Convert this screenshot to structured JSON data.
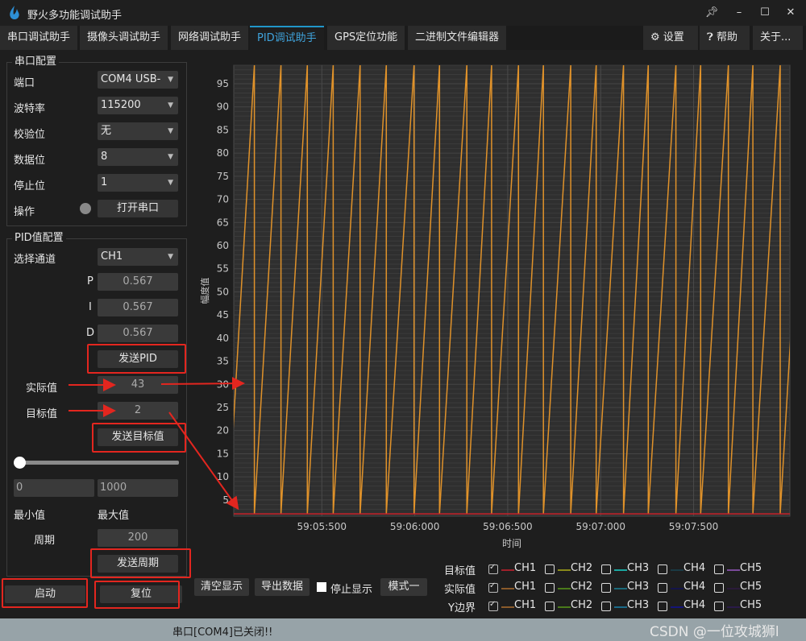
{
  "window": {
    "title": "野火多功能调试助手",
    "controls": [
      "pin",
      "minimize",
      "maximize",
      "close"
    ]
  },
  "tabs": [
    {
      "label": "串口调试助手",
      "active": false
    },
    {
      "label": "摄像头调试助手",
      "active": false
    },
    {
      "label": "网络调试助手",
      "active": false
    },
    {
      "label": "PID调试助手",
      "active": true
    },
    {
      "label": "GPS定位功能",
      "active": false
    },
    {
      "label": "二进制文件编辑器",
      "active": false
    }
  ],
  "right_tabs": {
    "settings": "设置",
    "help": "帮助",
    "about": "关于..."
  },
  "serial": {
    "title": "串口配置",
    "port_label": "端口",
    "port_value": "COM4 USB-",
    "baud_label": "波特率",
    "baud_value": "115200",
    "parity_label": "校验位",
    "parity_value": "无",
    "databits_label": "数据位",
    "databits_value": "8",
    "stopbits_label": "停止位",
    "stopbits_value": "1",
    "op_label": "操作",
    "open_button": "打开串口",
    "status_led": "#888888"
  },
  "pid": {
    "title": "PID值配置",
    "channel_label": "选择通道",
    "channel_value": "CH1",
    "p_label": "P",
    "p_value": "0.567",
    "i_label": "I",
    "i_value": "0.567",
    "d_label": "D",
    "d_value": "0.567",
    "send_pid": "发送PID",
    "actual_label": "实际值",
    "actual_value": "43",
    "target_label": "目标值",
    "target_value": "2",
    "send_target": "发送目标值",
    "slider_fraction": 0,
    "min_value": "0",
    "max_value": "1000",
    "min_label": "最小值",
    "max_label": "最大值",
    "period_label": "周期",
    "period_value": "200",
    "send_period": "发送周期",
    "start": "启动",
    "reset": "复位"
  },
  "toolbar": {
    "clear": "清空显示",
    "export": "导出数据",
    "stop_display": "停止显示",
    "stop_checked": false,
    "mode": "模式一"
  },
  "legend": {
    "rows": [
      {
        "label": "目标值",
        "items": [
          {
            "ch": "CH1",
            "checked": true,
            "color": "#a0202a"
          },
          {
            "ch": "CH2",
            "checked": false,
            "color": "#8a8a1a"
          },
          {
            "ch": "CH3",
            "checked": false,
            "color": "#1aa6a0"
          },
          {
            "ch": "CH4",
            "checked": false,
            "color": "#1a3a44"
          },
          {
            "ch": "CH5",
            "checked": false,
            "color": "#7a4a9a"
          }
        ]
      },
      {
        "label": "实际值",
        "items": [
          {
            "ch": "CH1",
            "checked": true,
            "color": "#8a5a2a"
          },
          {
            "ch": "CH2",
            "checked": false,
            "color": "#4a7a1a"
          },
          {
            "ch": "CH3",
            "checked": false,
            "color": "#1a6a7a"
          },
          {
            "ch": "CH4",
            "checked": false,
            "color": "#14144a"
          },
          {
            "ch": "CH5",
            "checked": false,
            "color": "#2a1a3a"
          }
        ]
      },
      {
        "label": "Y边界",
        "items": [
          {
            "ch": "CH1",
            "checked": true,
            "color": "#8a5a2a"
          },
          {
            "ch": "CH2",
            "checked": false,
            "color": "#4a7a1a"
          },
          {
            "ch": "CH3",
            "checked": false,
            "color": "#1a6a8a"
          },
          {
            "ch": "CH4",
            "checked": false,
            "color": "#14147a"
          },
          {
            "ch": "CH5",
            "checked": false,
            "color": "#2a1a4a"
          }
        ]
      }
    ]
  },
  "status": {
    "text": "串口[COM4]已关闭!!"
  },
  "watermark": "CSDN @一位攻城狮l",
  "chart_data": {
    "type": "line",
    "xlabel": "时间",
    "ylabel": "幅度值",
    "xlim": [
      "59:05:026",
      "59:08:018"
    ],
    "ylim": [
      1.5,
      99
    ],
    "x_ticks": [
      "59:05:500",
      "59:06:000",
      "59:06:500",
      "59:07:000",
      "59:07:500"
    ],
    "y_ticks": [
      5,
      10,
      15,
      20,
      25,
      30,
      35,
      40,
      45,
      50,
      55,
      60,
      65,
      70,
      75,
      80,
      85,
      90,
      95
    ],
    "grid": true,
    "series": [
      {
        "role": "actual CH1",
        "color": "#e0922a",
        "points": [
          [
            "59:04:996",
            2
          ],
          [
            "59:05:137",
            99
          ],
          [
            "59:05:137",
            2
          ],
          [
            "59:05:280",
            99
          ],
          [
            "59:05:280",
            2
          ],
          [
            "59:05:422",
            99
          ],
          [
            "59:05:422",
            2
          ],
          [
            "59:05:561",
            99
          ],
          [
            "59:05:561",
            2
          ],
          [
            "59:05:706",
            99
          ],
          [
            "59:05:706",
            2
          ],
          [
            "59:05:847",
            99
          ],
          [
            "59:05:847",
            2
          ],
          [
            "59:05:996",
            99
          ],
          [
            "59:05:996",
            2
          ],
          [
            "59:06:133",
            99
          ],
          [
            "59:06:133",
            2
          ],
          [
            "59:06:280",
            99
          ],
          [
            "59:06:280",
            2
          ],
          [
            "59:06:413",
            99
          ],
          [
            "59:06:413",
            2
          ],
          [
            "59:06:558",
            99
          ],
          [
            "59:06:558",
            2
          ],
          [
            "59:06:692",
            99
          ],
          [
            "59:06:692",
            2
          ],
          [
            "59:06:839",
            99
          ],
          [
            "59:06:839",
            2
          ],
          [
            "59:06:976",
            99
          ],
          [
            "59:06:976",
            2
          ],
          [
            "59:07:123",
            99
          ],
          [
            "59:07:123",
            2
          ],
          [
            "59:07:256",
            99
          ],
          [
            "59:07:256",
            2
          ],
          [
            "59:07:405",
            99
          ],
          [
            "59:07:405",
            2
          ],
          [
            "59:07:538",
            99
          ],
          [
            "59:07:538",
            2
          ],
          [
            "59:07:687",
            99
          ],
          [
            "59:07:687",
            2
          ],
          [
            "59:07:819",
            99
          ],
          [
            "59:07:819",
            2
          ],
          [
            "59:07:966",
            99
          ],
          [
            "59:07:966",
            2
          ],
          [
            "59:08:108",
            99
          ]
        ]
      },
      {
        "role": "target CH1",
        "color": "#c8202a",
        "points": [
          [
            "59:05:026",
            2
          ],
          [
            "59:08:018",
            2
          ]
        ]
      }
    ]
  }
}
